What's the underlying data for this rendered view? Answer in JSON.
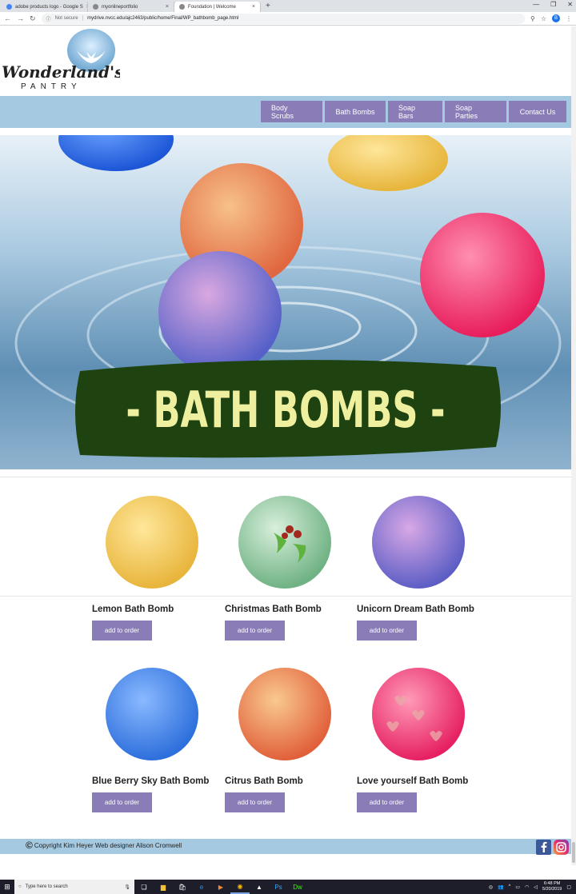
{
  "browser": {
    "tabs": [
      {
        "title": "adobe products logo - Google S",
        "active": false
      },
      {
        "title": "myonlineportfolio",
        "active": false
      },
      {
        "title": "Foundation | Welcome",
        "active": true
      }
    ],
    "new_tab": "+",
    "security": "Not secure",
    "url": "mydrive.nvcc.edu/ajc2463/public/home/Final/WP_bathbomb_page.html",
    "profile_initial": "B"
  },
  "site": {
    "logo": {
      "line1": "Wonderland's",
      "line2": "PANTRY"
    },
    "nav": [
      "Body Scrubs",
      "Bath Bombs",
      "Soap Bars",
      "Soap Parties",
      "Contact Us"
    ],
    "banner_title": "- BATH BOMBS -",
    "products": [
      {
        "name": "Lemon Bath Bomb",
        "button": "add to order",
        "color": "#f2c94c"
      },
      {
        "name": "Christmas Bath Bomb",
        "button": "add to order",
        "color": "#8fc49a"
      },
      {
        "name": "Unicorn Dream Bath Bomb",
        "button": "add to order",
        "color": "#7b6fc6"
      },
      {
        "name": "Blue Berry Sky Bath Bomb",
        "button": "add to order",
        "color": "#4a8ee0"
      },
      {
        "name": "Citrus Bath Bomb",
        "button": "add to order",
        "color": "#f08a4b"
      },
      {
        "name": "Love yourself Bath Bomb",
        "button": "add to order",
        "color": "#f04b7a"
      }
    ],
    "footer": {
      "copyright": "Copyright Kim Heyer Web designer Alison Cromwell"
    }
  },
  "taskbar": {
    "search_placeholder": "Type here to search",
    "time": "6:48 PM",
    "date": "5/20/2019"
  },
  "colors": {
    "nav_bg": "#a5c9e1",
    "button": "#8a7cb7",
    "banner": "#1f4211",
    "banner_text": "#eef0a0"
  }
}
